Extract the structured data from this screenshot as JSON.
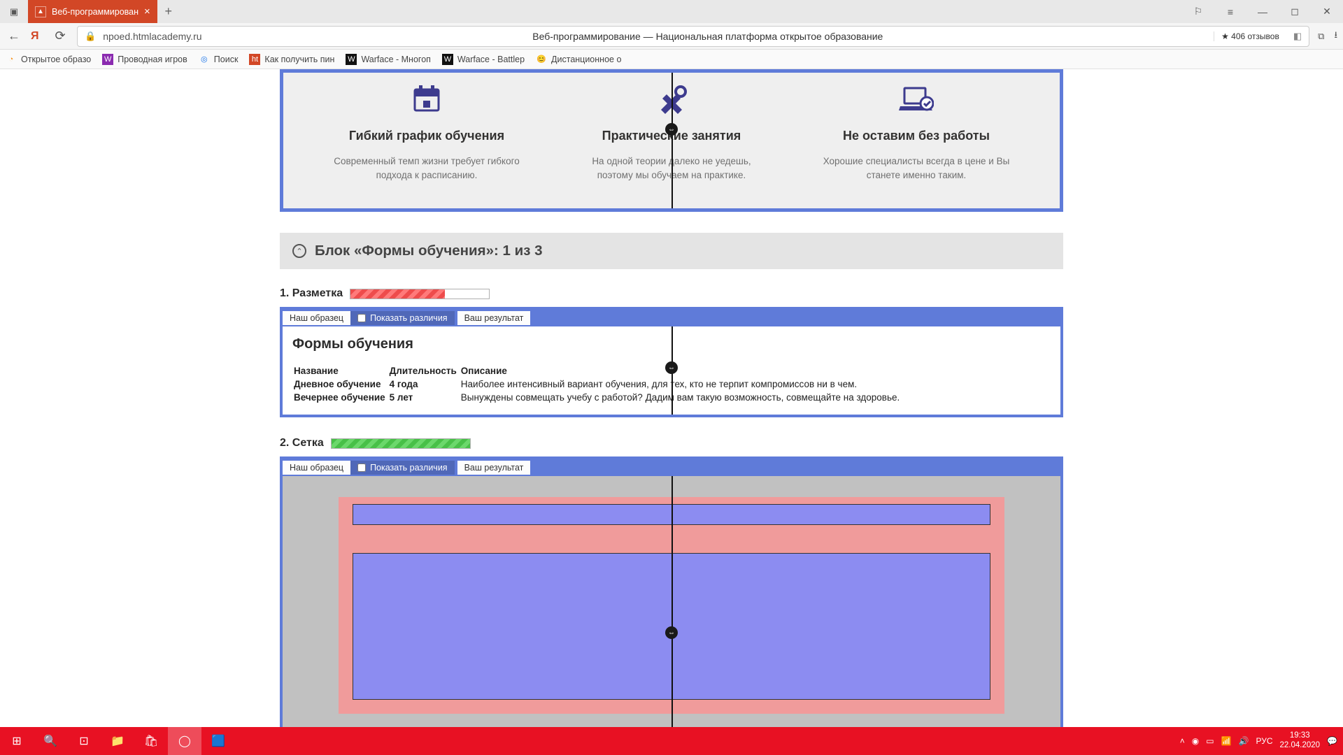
{
  "browser": {
    "tab_title": "Веб-программирован",
    "url_host": "npoed.htmlacademy.ru",
    "page_title_in_url": "Веб-программирование — Национальная платформа открытое образование",
    "reviews": "★ 406 отзывов"
  },
  "bookmarks": [
    {
      "label": "Открытое образо"
    },
    {
      "label": "Проводная игров"
    },
    {
      "label": "Поиск"
    },
    {
      "label": "Как получить пин"
    },
    {
      "label": "Warface - Многоп"
    },
    {
      "label": "Warface - Battlep"
    },
    {
      "label": "Дистанционное о"
    }
  ],
  "features": [
    {
      "title": "Гибкий график обучения",
      "desc": "Современный темп жизни требует гибкого подхода к расписанию."
    },
    {
      "title": "Практические занятия",
      "desc": "На одной теории далеко не уедешь, поэтому мы обучаем на практике."
    },
    {
      "title": "Не оставим без работы",
      "desc": "Хорошие специалисты всегда в цене и Вы станете именно таким."
    }
  ],
  "accordion": {
    "title": "Блок «Формы обучения»: 1 из 3"
  },
  "section1": {
    "title": "1. Разметка",
    "tabs": {
      "left": "Наш образец",
      "diff": "Показать различия",
      "right": "Ваш результат"
    },
    "heading": "Формы обучения",
    "thead": [
      "Название",
      "Длительность",
      "Описание"
    ],
    "rows": [
      [
        "Дневное обучение",
        "4 года",
        "Наиболее интенсивный вариант обучения, для тех, кто не терпит компромиссов ни в чем."
      ],
      [
        "Вечернее обучение",
        "5 лет",
        "Вынуждены совмещать учебу с работой? Дадим вам такую возможность, совмещайте на здоровье."
      ]
    ]
  },
  "section2": {
    "title": "2. Сетка",
    "tabs": {
      "left": "Наш образец",
      "diff": "Показать различия",
      "right": "Ваш результат"
    }
  },
  "taskbar": {
    "time": "19:33",
    "date": "22.04.2020",
    "lang": "РУС"
  }
}
